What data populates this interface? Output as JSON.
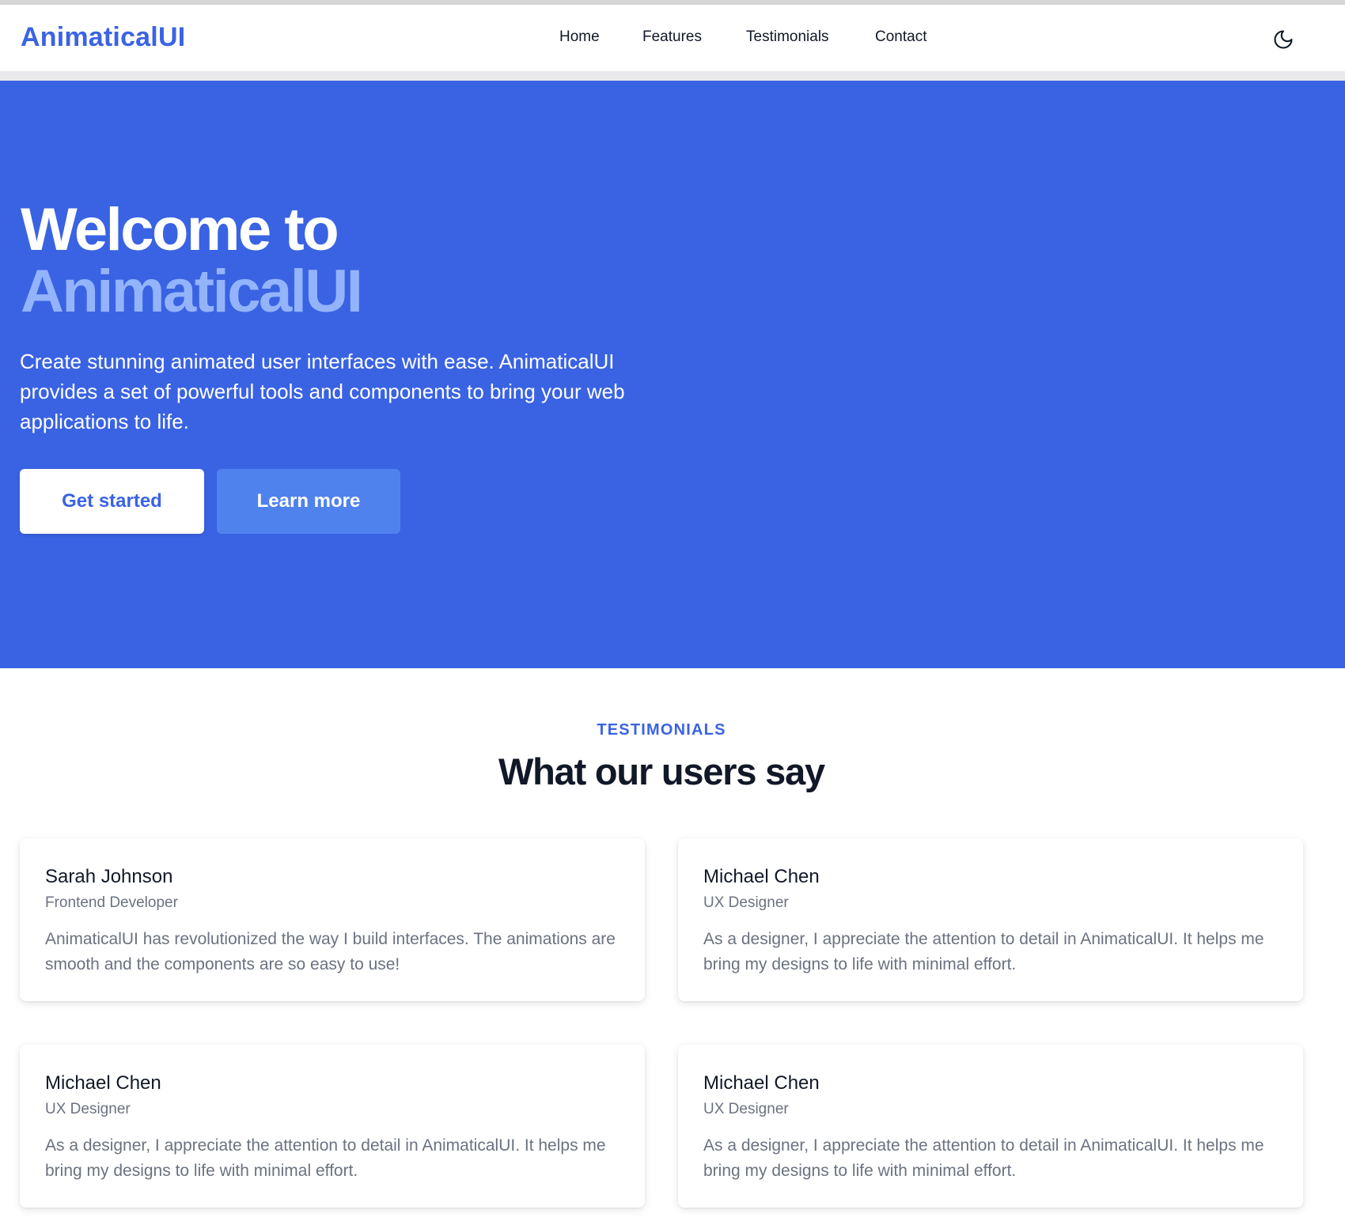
{
  "colors": {
    "brand": "#3a63e3",
    "accent_light": "#93b4fb",
    "secondary_button": "#5082ee",
    "text_dark": "#111827",
    "text_muted": "#6b7280"
  },
  "header": {
    "brand": "AnimaticalUI",
    "nav": [
      {
        "label": "Home"
      },
      {
        "label": "Features"
      },
      {
        "label": "Testimonials"
      },
      {
        "label": "Contact"
      }
    ],
    "theme_toggle_icon": "moon-icon"
  },
  "hero": {
    "title_line1": "Welcome to",
    "title_line2": "AnimaticalUI",
    "subtitle": "Create stunning animated user interfaces with ease. AnimaticalUI provides a set of powerful tools and components to bring your web applications to life.",
    "primary_button": "Get started",
    "secondary_button": "Learn more"
  },
  "testimonials": {
    "eyebrow": "TESTIMONIALS",
    "title": "What our users say",
    "items": [
      {
        "name": "Sarah Johnson",
        "role": "Frontend Developer",
        "quote": "AnimaticalUI has revolutionized the way I build interfaces. The animations are smooth and the components are so easy to use!"
      },
      {
        "name": "Michael Chen",
        "role": "UX Designer",
        "quote": "As a designer, I appreciate the attention to detail in AnimaticalUI. It helps me bring my designs to life with minimal effort."
      },
      {
        "name": "Michael Chen",
        "role": "UX Designer",
        "quote": "As a designer, I appreciate the attention to detail in AnimaticalUI. It helps me bring my designs to life with minimal effort."
      },
      {
        "name": "Michael Chen",
        "role": "UX Designer",
        "quote": "As a designer, I appreciate the attention to detail in AnimaticalUI. It helps me bring my designs to life with minimal effort."
      }
    ]
  }
}
